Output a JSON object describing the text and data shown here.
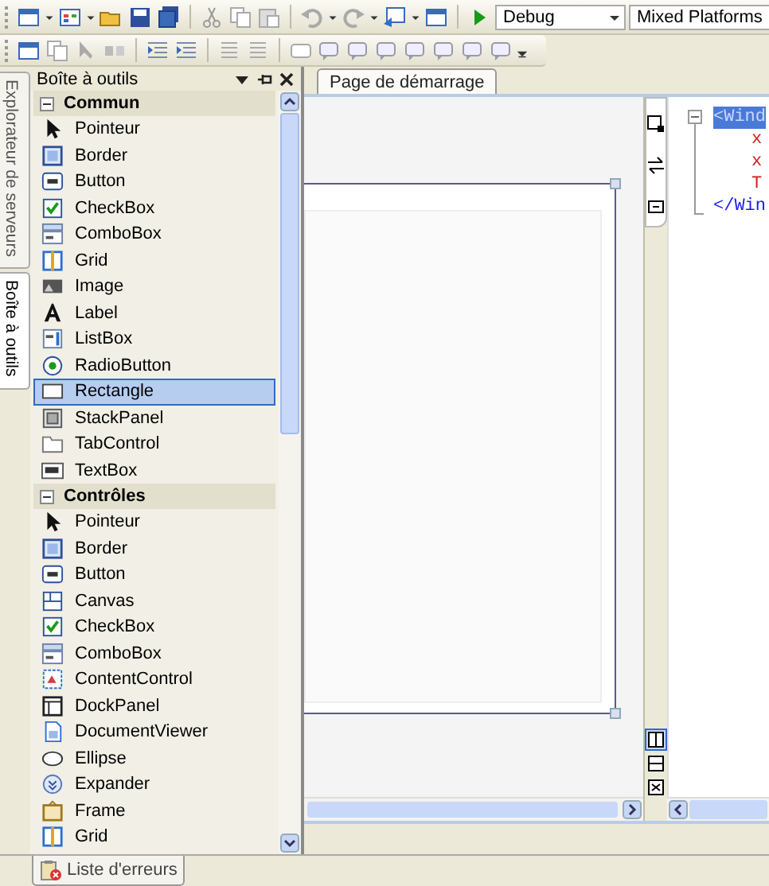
{
  "toolbar": {
    "configuration": "Debug",
    "platform": "Mixed Platforms"
  },
  "side_tabs": [
    {
      "label": "Explorateur de serveurs",
      "selected": false
    },
    {
      "label": "Boîte à outils",
      "selected": true
    }
  ],
  "toolbox": {
    "title": "Boîte à outils",
    "groups": [
      {
        "name": "Commun",
        "expanded": true,
        "items": [
          {
            "label": "Pointeur",
            "kind": "pointer",
            "selected": false
          },
          {
            "label": "Border",
            "kind": "border",
            "selected": false
          },
          {
            "label": "Button",
            "kind": "button",
            "selected": false
          },
          {
            "label": "CheckBox",
            "kind": "checkbox",
            "selected": false
          },
          {
            "label": "ComboBox",
            "kind": "combobox",
            "selected": false
          },
          {
            "label": "Grid",
            "kind": "grid",
            "selected": false
          },
          {
            "label": "Image",
            "kind": "image",
            "selected": false
          },
          {
            "label": "Label",
            "kind": "label",
            "selected": false
          },
          {
            "label": "ListBox",
            "kind": "listbox",
            "selected": false
          },
          {
            "label": "RadioButton",
            "kind": "radio",
            "selected": false
          },
          {
            "label": "Rectangle",
            "kind": "rectangle",
            "selected": true
          },
          {
            "label": "StackPanel",
            "kind": "stackpanel",
            "selected": false
          },
          {
            "label": "TabControl",
            "kind": "tabcontrol",
            "selected": false
          },
          {
            "label": "TextBox",
            "kind": "textbox",
            "selected": false
          }
        ]
      },
      {
        "name": "Contrôles",
        "expanded": true,
        "items": [
          {
            "label": "Pointeur",
            "kind": "pointer",
            "selected": false
          },
          {
            "label": "Border",
            "kind": "border",
            "selected": false
          },
          {
            "label": "Button",
            "kind": "button",
            "selected": false
          },
          {
            "label": "Canvas",
            "kind": "canvas",
            "selected": false
          },
          {
            "label": "CheckBox",
            "kind": "checkbox",
            "selected": false
          },
          {
            "label": "ComboBox",
            "kind": "combobox",
            "selected": false
          },
          {
            "label": "ContentControl",
            "kind": "contentcontrol",
            "selected": false
          },
          {
            "label": "DockPanel",
            "kind": "dockpanel",
            "selected": false
          },
          {
            "label": "DocumentViewer",
            "kind": "documentviewer",
            "selected": false
          },
          {
            "label": "Ellipse",
            "kind": "ellipse",
            "selected": false
          },
          {
            "label": "Expander",
            "kind": "expander",
            "selected": false
          },
          {
            "label": "Frame",
            "kind": "frame",
            "selected": false
          },
          {
            "label": "Grid",
            "kind": "grid",
            "selected": false
          }
        ]
      }
    ]
  },
  "document_tabs": [
    {
      "label": "Page de démarrage",
      "selected": false
    }
  ],
  "xaml_lines": [
    {
      "text": "<Wind",
      "kind": "tag",
      "selected": true
    },
    {
      "text": "x",
      "kind": "attribute",
      "selected": false
    },
    {
      "text": "x",
      "kind": "attribute",
      "selected": false
    },
    {
      "text": "T",
      "kind": "attribute",
      "selected": false
    },
    {
      "text": "</Win",
      "kind": "tag",
      "selected": false
    }
  ],
  "bottom_tabs": [
    {
      "label": "Liste d'erreurs",
      "selected": false
    }
  ]
}
